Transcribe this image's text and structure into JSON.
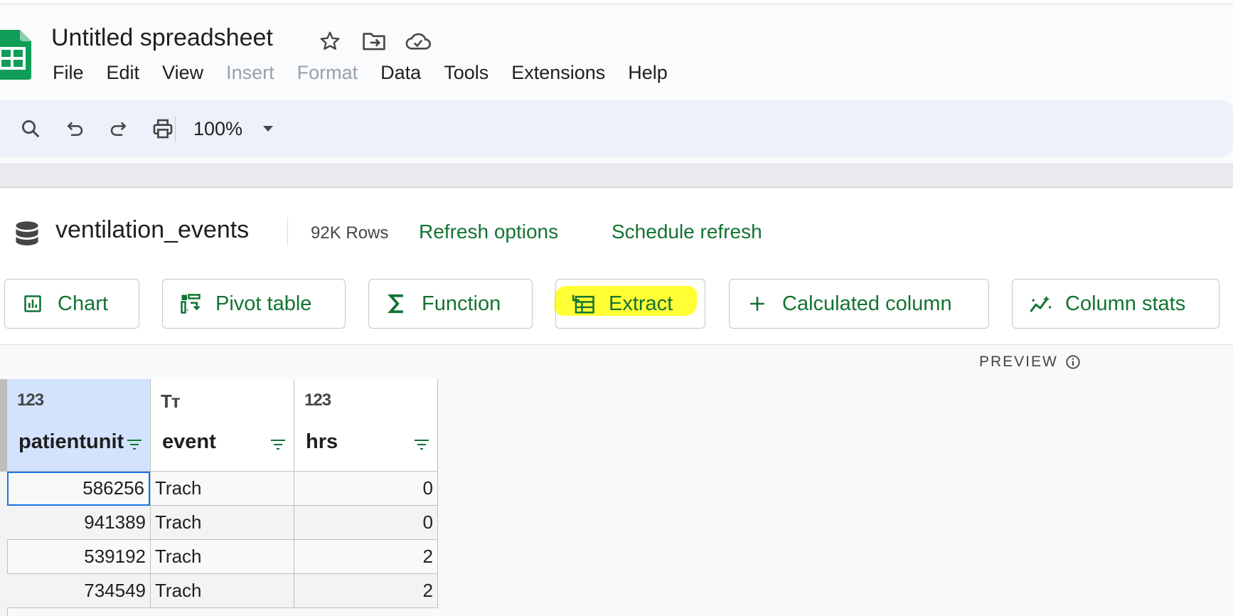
{
  "app": {
    "title": "Untitled spreadsheet",
    "title_icons": [
      "star-icon",
      "move-to-folder-icon",
      "cloud-saved-icon"
    ],
    "menu": [
      {
        "label": "File",
        "disabled": false
      },
      {
        "label": "Edit",
        "disabled": false
      },
      {
        "label": "View",
        "disabled": false
      },
      {
        "label": "Insert",
        "disabled": true
      },
      {
        "label": "Format",
        "disabled": true
      },
      {
        "label": "Data",
        "disabled": false
      },
      {
        "label": "Tools",
        "disabled": false
      },
      {
        "label": "Extensions",
        "disabled": false
      },
      {
        "label": "Help",
        "disabled": false
      }
    ]
  },
  "toolbar": {
    "icons": [
      "search-icon",
      "undo-icon",
      "redo-icon",
      "print-icon"
    ],
    "zoom": "100%"
  },
  "datasource": {
    "name": "ventilation_events",
    "rows": "92K Rows",
    "refresh_options": "Refresh options",
    "schedule_refresh": "Schedule refresh",
    "actions": [
      {
        "label": "Chart",
        "icon": "chart-icon"
      },
      {
        "label": "Pivot table",
        "icon": "pivot-table-icon"
      },
      {
        "label": "Function",
        "icon": "sigma-icon"
      },
      {
        "label": "Extract",
        "icon": "extract-icon",
        "highlighted": true
      },
      {
        "label": "Calculated column",
        "icon": "plus-icon"
      },
      {
        "label": "Column stats",
        "icon": "column-stats-icon"
      }
    ]
  },
  "preview": {
    "label": "PREVIEW"
  },
  "table": {
    "columns": [
      {
        "type_label": "123",
        "name": "patientunitstayid",
        "visible_name": "patientunit",
        "selected": true
      },
      {
        "type_label": "Tт",
        "name": "event",
        "visible_name": "event",
        "selected": false
      },
      {
        "type_label": "123",
        "name": "hrs",
        "visible_name": "hrs",
        "selected": false
      }
    ],
    "rows": [
      [
        "586256",
        "Trach",
        "0"
      ],
      [
        "941389",
        "Trach",
        "0"
      ],
      [
        "539192",
        "Trach",
        "2"
      ],
      [
        "734549",
        "Trach",
        "2"
      ]
    ]
  },
  "colors": {
    "accent_green": "#137333",
    "selection_blue": "#1a73e8",
    "highlight_yellow": "#ffff33"
  }
}
